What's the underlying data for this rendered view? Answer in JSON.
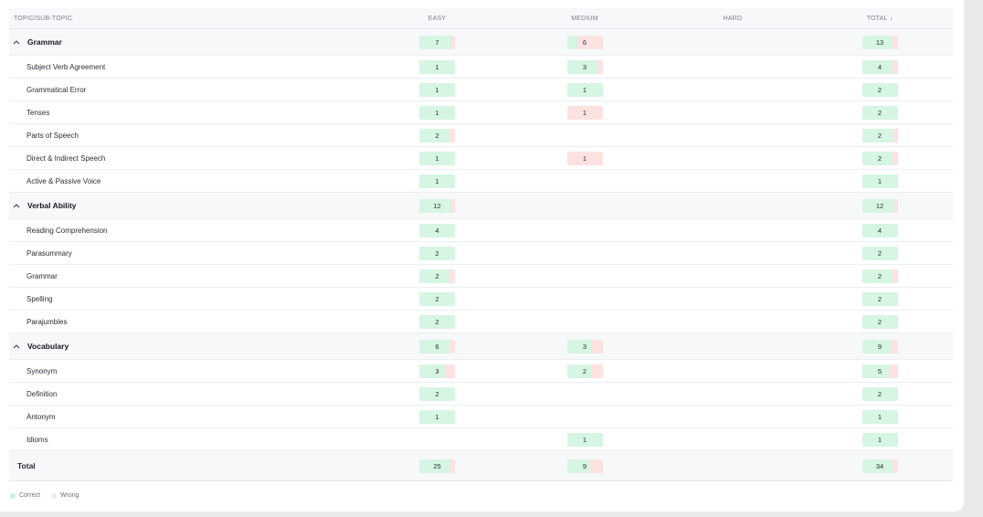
{
  "header": {
    "topic": "TOPIC/SUB-TOPIC",
    "easy": "EASY",
    "medium": "MEDIUM",
    "hard": "HARD",
    "total": "TOTAL",
    "sort_arrow": "↓"
  },
  "rows": [
    {
      "type": "topic",
      "name": "Grammar",
      "easy": {
        "v": "7",
        "c": 0.9
      },
      "medium": {
        "v": "6",
        "c": 0.3
      },
      "hard": null,
      "total": {
        "v": "13",
        "c": 0.85
      }
    },
    {
      "type": "sub",
      "name": "Subject Verb Agreement",
      "easy": {
        "v": "1",
        "c": 1
      },
      "medium": {
        "v": "3",
        "c": 0.85
      },
      "hard": null,
      "total": {
        "v": "4",
        "c": 0.85
      }
    },
    {
      "type": "sub",
      "name": "Grammatical Error",
      "easy": {
        "v": "1",
        "c": 1
      },
      "medium": {
        "v": "1",
        "c": 1
      },
      "hard": null,
      "total": {
        "v": "2",
        "c": 1
      }
    },
    {
      "type": "sub",
      "name": "Tenses",
      "easy": {
        "v": "1",
        "c": 1
      },
      "medium": {
        "v": "1",
        "c": 0
      },
      "hard": null,
      "total": {
        "v": "2",
        "c": 1
      }
    },
    {
      "type": "sub",
      "name": "Parts of Speech",
      "easy": {
        "v": "2",
        "c": 0.85
      },
      "medium": null,
      "hard": null,
      "total": {
        "v": "2",
        "c": 0.85
      }
    },
    {
      "type": "sub",
      "name": "Direct & Indirect Speech",
      "easy": {
        "v": "1",
        "c": 1
      },
      "medium": {
        "v": "1",
        "c": 0
      },
      "hard": null,
      "total": {
        "v": "2",
        "c": 0.85
      }
    },
    {
      "type": "sub",
      "name": "Active & Passive Voice",
      "easy": {
        "v": "1",
        "c": 1
      },
      "medium": null,
      "hard": null,
      "total": {
        "v": "1",
        "c": 1
      }
    },
    {
      "type": "topic",
      "name": "Verbal Ability",
      "easy": {
        "v": "12",
        "c": 0.9
      },
      "medium": null,
      "hard": null,
      "total": {
        "v": "12",
        "c": 0.9
      }
    },
    {
      "type": "sub",
      "name": "Reading Comprehension",
      "easy": {
        "v": "4",
        "c": 1
      },
      "medium": null,
      "hard": null,
      "total": {
        "v": "4",
        "c": 1
      }
    },
    {
      "type": "sub",
      "name": "Parasummary",
      "easy": {
        "v": "2",
        "c": 1
      },
      "medium": null,
      "hard": null,
      "total": {
        "v": "2",
        "c": 1
      }
    },
    {
      "type": "sub",
      "name": "Grammar",
      "easy": {
        "v": "2",
        "c": 0.85
      },
      "medium": null,
      "hard": null,
      "total": {
        "v": "2",
        "c": 0.85
      }
    },
    {
      "type": "sub",
      "name": "Spelling",
      "easy": {
        "v": "2",
        "c": 1
      },
      "medium": null,
      "hard": null,
      "total": {
        "v": "2",
        "c": 1
      }
    },
    {
      "type": "sub",
      "name": "Parajumbles",
      "easy": {
        "v": "2",
        "c": 1
      },
      "medium": null,
      "hard": null,
      "total": {
        "v": "2",
        "c": 1
      }
    },
    {
      "type": "topic",
      "name": "Vocabulary",
      "easy": {
        "v": "6",
        "c": 0.85
      },
      "medium": {
        "v": "3",
        "c": 0.7
      },
      "hard": null,
      "total": {
        "v": "9",
        "c": 0.8
      }
    },
    {
      "type": "sub",
      "name": "Synonym",
      "easy": {
        "v": "3",
        "c": 0.75
      },
      "medium": {
        "v": "2",
        "c": 0.7
      },
      "hard": null,
      "total": {
        "v": "5",
        "c": 0.75
      }
    },
    {
      "type": "sub",
      "name": "Definition",
      "easy": {
        "v": "2",
        "c": 1
      },
      "medium": null,
      "hard": null,
      "total": {
        "v": "2",
        "c": 1
      }
    },
    {
      "type": "sub",
      "name": "Antonym",
      "easy": {
        "v": "1",
        "c": 1
      },
      "medium": null,
      "hard": null,
      "total": {
        "v": "1",
        "c": 1
      }
    },
    {
      "type": "sub",
      "name": "Idioms",
      "easy": null,
      "medium": {
        "v": "1",
        "c": 1
      },
      "hard": null,
      "total": {
        "v": "1",
        "c": 1
      }
    },
    {
      "type": "total",
      "name": "Total",
      "easy": {
        "v": "25",
        "c": 0.88
      },
      "medium": {
        "v": "9",
        "c": 0.65
      },
      "hard": null,
      "total": {
        "v": "34",
        "c": 0.85
      }
    }
  ],
  "legend": {
    "correct": "Correct",
    "wrong": "Wrong"
  },
  "colors": {
    "correct": "#d6f5e3",
    "wrong": "#fde2e2",
    "correct_dot": "#c9f0da",
    "wrong_dot": "#ececec"
  }
}
